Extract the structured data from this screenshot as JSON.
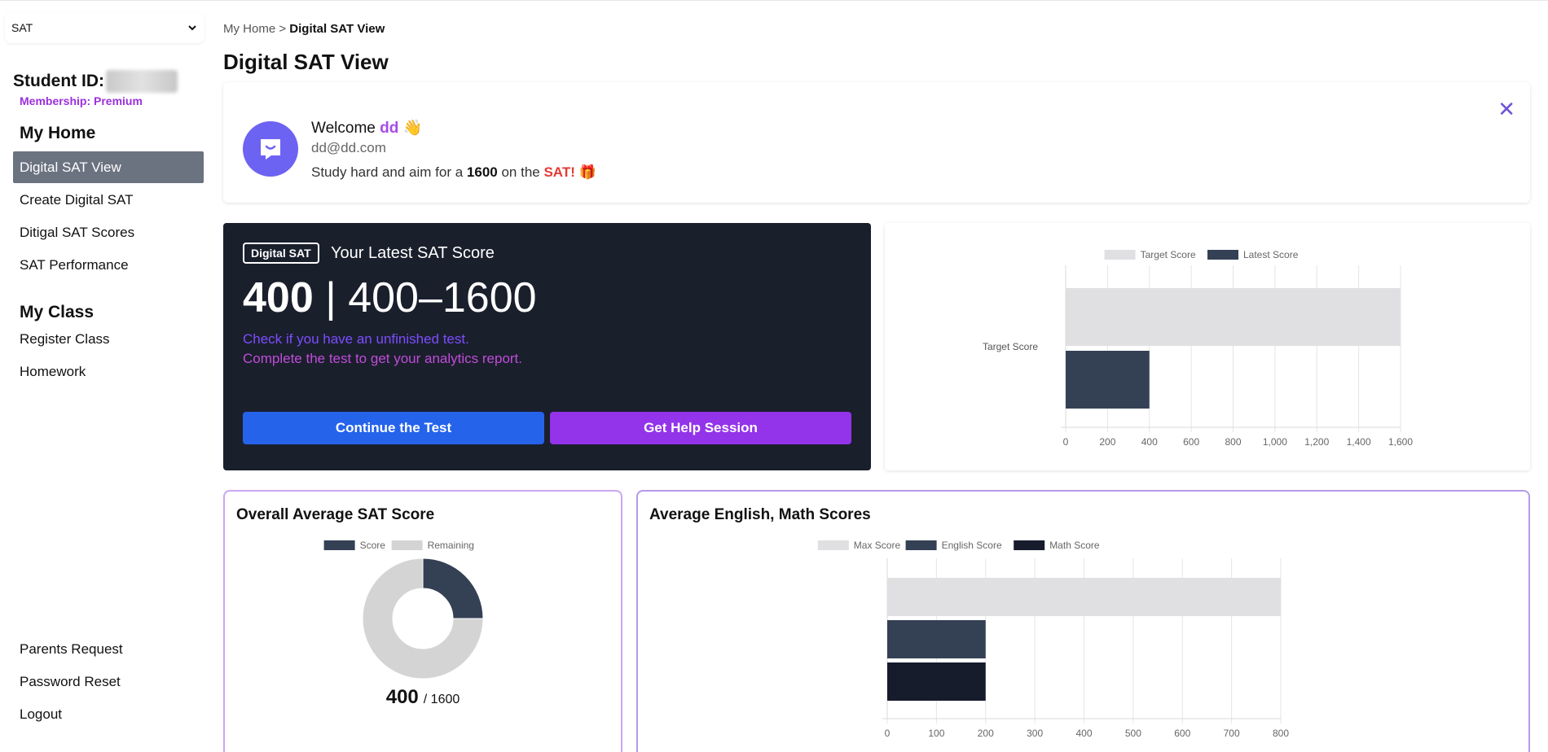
{
  "sidebar": {
    "exam_select": "SAT",
    "student_id_label": "Student ID:",
    "membership": "Membership: Premium",
    "my_home_title": "My Home",
    "home_items": [
      {
        "label": "Digital SAT View",
        "active": true
      },
      {
        "label": "Create Digital SAT",
        "active": false
      },
      {
        "label": "Ditigal SAT Scores",
        "active": false
      },
      {
        "label": "SAT Performance",
        "active": false
      }
    ],
    "my_class_title": "My Class",
    "class_items": [
      {
        "label": "Register Class"
      },
      {
        "label": "Homework"
      }
    ],
    "bottom_items": [
      {
        "label": "Parents Request"
      },
      {
        "label": "Password Reset"
      },
      {
        "label": "Logout"
      }
    ]
  },
  "breadcrumb": {
    "home": "My Home",
    "separator": ">",
    "current": "Digital SAT View"
  },
  "page_title": "Digital SAT View",
  "welcome": {
    "greeting": "Welcome",
    "name": "dd",
    "wave": "👋",
    "email": "dd@dd.com",
    "motto_pre": "Study hard and aim for a",
    "motto_target": "1600",
    "motto_mid": "on the",
    "motto_exam": "SAT!",
    "motto_emoji": "🎁"
  },
  "score_card": {
    "badge": "Digital SAT",
    "label": "Your Latest SAT Score",
    "score": "400",
    "separator": "|",
    "range": "400–1600",
    "info_line1": "Check if you have an unfinished test.",
    "info_line2": "Complete the test to get your analytics report.",
    "continue_button": "Continue the Test",
    "help_button": "Get Help Session"
  },
  "colors": {
    "light_bar": "#e0e0e2",
    "dark_bar": "#344054",
    "darker_bar": "#161c2c",
    "remaining": "#d4d4d4"
  },
  "chart_data": [
    {
      "type": "bar",
      "orientation": "horizontal",
      "categories": [
        "Target Score"
      ],
      "series": [
        {
          "name": "Target Score",
          "values": [
            1600
          ]
        },
        {
          "name": "Latest Score",
          "values": [
            400
          ]
        }
      ],
      "xlim": [
        0,
        1600
      ],
      "xticks": [
        "0",
        "200",
        "400",
        "600",
        "800",
        "1,000",
        "1,200",
        "1,400",
        "1,600"
      ],
      "legend": "top",
      "grid": true
    },
    {
      "type": "pie",
      "title": "Overall Average SAT Score",
      "labels": [
        "Score",
        "Remaining"
      ],
      "values": [
        400,
        1200
      ],
      "center_value": "400",
      "center_total": "/ 1600",
      "legend": "top"
    },
    {
      "type": "bar",
      "orientation": "horizontal",
      "title": "Average English, Math Scores",
      "series": [
        {
          "name": "Max Score",
          "values": [
            800
          ]
        },
        {
          "name": "English Score",
          "values": [
            200
          ]
        },
        {
          "name": "Math Score",
          "values": [
            200
          ]
        }
      ],
      "xlim": [
        0,
        800
      ],
      "xticks": [
        "0",
        "100",
        "200",
        "300",
        "400",
        "500",
        "600",
        "700",
        "800"
      ],
      "legend": "top",
      "grid": true
    }
  ]
}
